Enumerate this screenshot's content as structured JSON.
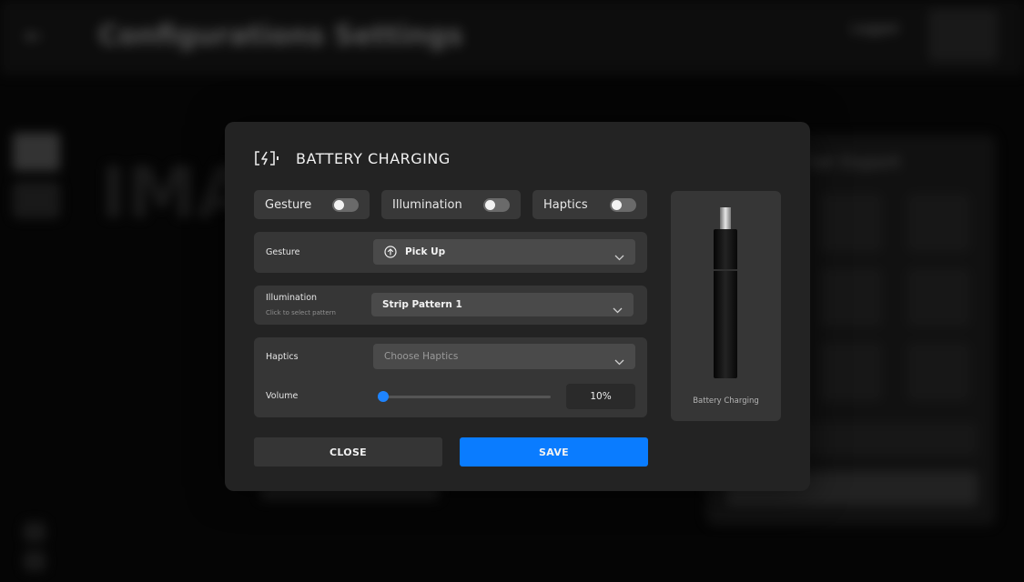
{
  "background": {
    "title": "Configurations Settings",
    "header_label": "Logged",
    "big_text": "IMA",
    "panel_title": "Set Export"
  },
  "modal": {
    "title": "BATTERY CHARGING",
    "header_icon": "battery-charging-icon",
    "toggles": [
      {
        "label": "Gesture",
        "on": false
      },
      {
        "label": "Illumination",
        "on": false
      },
      {
        "label": "Haptics",
        "on": false
      }
    ],
    "gesture": {
      "label": "Gesture",
      "icon": "arrow-up-circle-icon",
      "value": "Pick Up"
    },
    "illumination": {
      "label": "Illumination",
      "sublabel": "Click to select pattern",
      "value": "Strip Pattern 1"
    },
    "haptics": {
      "label": "Haptics",
      "placeholder": "Choose Haptics"
    },
    "volume": {
      "label": "Volume",
      "value": 10,
      "display": "10%"
    },
    "preview": {
      "caption": "Battery Charging"
    },
    "buttons": {
      "close": "CLOSE",
      "save": "SAVE"
    }
  },
  "colors": {
    "accent": "#0a7cff",
    "modal_bg": "#232323",
    "section_bg": "#363636"
  }
}
